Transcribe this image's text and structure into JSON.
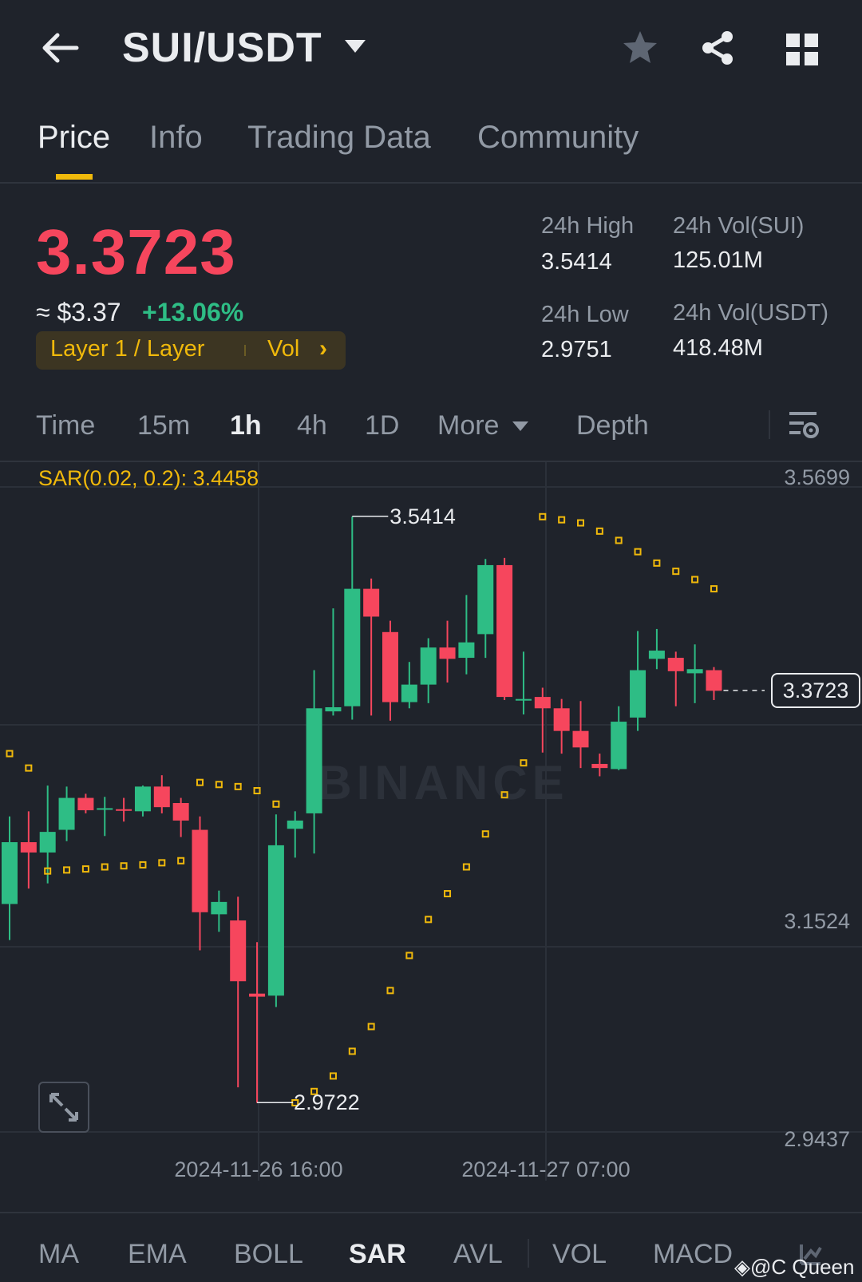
{
  "header": {
    "pair": "SUI/USDT",
    "icons": [
      "back-arrow-icon",
      "caret-down-icon",
      "star-icon",
      "share-icon",
      "grid-icon"
    ]
  },
  "tabs": [
    {
      "label": "Price",
      "active": true
    },
    {
      "label": "Info",
      "active": false
    },
    {
      "label": "Trading Data",
      "active": false
    },
    {
      "label": "Community",
      "active": false
    }
  ],
  "ticker": {
    "last_price": "3.3723",
    "usd_approx": "≈ $3.37",
    "change_pct": "+13.06%",
    "tag_sector": "Layer 1 / Layer",
    "tag_vol": "Vol",
    "stats": {
      "high_label": "24h High",
      "high_value": "3.5414",
      "low_label": "24h Low",
      "low_value": "2.9751",
      "vol_base_label": "24h Vol(SUI)",
      "vol_base_value": "125.01M",
      "vol_quote_label": "24h Vol(USDT)",
      "vol_quote_value": "418.48M"
    },
    "colors": {
      "down": "#f6465d",
      "up": "#2ebd85",
      "accent": "#f0b90b"
    }
  },
  "intervals": [
    {
      "label": "Time",
      "active": false
    },
    {
      "label": "15m",
      "active": false
    },
    {
      "label": "1h",
      "active": true
    },
    {
      "label": "4h",
      "active": false
    },
    {
      "label": "1D",
      "active": false
    },
    {
      "label": "More",
      "active": false
    },
    {
      "label": "Depth",
      "active": false
    }
  ],
  "chart_data": {
    "type": "candlestick",
    "indicator_legend": "SAR(0.02, 0.2): 3.4458",
    "watermark": "BINANCE",
    "y_ticks": [
      "3.5699",
      "3.1524",
      "2.9437"
    ],
    "ylim": [
      2.9437,
      3.5699
    ],
    "x_labels": [
      "2024-11-26 16:00",
      "2024-11-27 07:00"
    ],
    "high_marker": "3.5414",
    "low_marker": "2.9722",
    "current_price": "3.3723",
    "candles": [
      {
        "o": 3.165,
        "h": 3.25,
        "l": 3.13,
        "c": 3.225
      },
      {
        "o": 3.225,
        "h": 3.255,
        "l": 3.18,
        "c": 3.215
      },
      {
        "o": 3.215,
        "h": 3.28,
        "l": 3.185,
        "c": 3.235
      },
      {
        "o": 3.237,
        "h": 3.279,
        "l": 3.226,
        "c": 3.268
      },
      {
        "o": 3.268,
        "h": 3.272,
        "l": 3.253,
        "c": 3.256
      },
      {
        "o": 3.258,
        "h": 3.269,
        "l": 3.231,
        "c": 3.258
      },
      {
        "o": 3.257,
        "h": 3.268,
        "l": 3.245,
        "c": 3.256
      },
      {
        "o": 3.255,
        "h": 3.28,
        "l": 3.25,
        "c": 3.279
      },
      {
        "o": 3.279,
        "h": 3.29,
        "l": 3.253,
        "c": 3.259
      },
      {
        "o": 3.263,
        "h": 3.268,
        "l": 3.23,
        "c": 3.246
      },
      {
        "o": 3.237,
        "h": 3.25,
        "l": 3.12,
        "c": 3.157
      },
      {
        "o": 3.155,
        "h": 3.178,
        "l": 3.138,
        "c": 3.167
      },
      {
        "o": 3.149,
        "h": 3.172,
        "l": 2.987,
        "c": 3.09
      },
      {
        "o": 3.078,
        "h": 3.128,
        "l": 2.972,
        "c": 3.075
      },
      {
        "o": 3.076,
        "h": 3.252,
        "l": 3.065,
        "c": 3.222
      },
      {
        "o": 3.238,
        "h": 3.255,
        "l": 3.21,
        "c": 3.246
      },
      {
        "o": 3.253,
        "h": 3.392,
        "l": 3.214,
        "c": 3.355
      },
      {
        "o": 3.352,
        "h": 3.452,
        "l": 3.348,
        "c": 3.356
      },
      {
        "o": 3.357,
        "h": 3.541,
        "l": 3.344,
        "c": 3.471
      },
      {
        "o": 3.471,
        "h": 3.481,
        "l": 3.348,
        "c": 3.444
      },
      {
        "o": 3.429,
        "h": 3.44,
        "l": 3.343,
        "c": 3.361
      },
      {
        "o": 3.361,
        "h": 3.4,
        "l": 3.355,
        "c": 3.378
      },
      {
        "o": 3.378,
        "h": 3.423,
        "l": 3.36,
        "c": 3.414
      },
      {
        "o": 3.414,
        "h": 3.44,
        "l": 3.38,
        "c": 3.403
      },
      {
        "o": 3.404,
        "h": 3.465,
        "l": 3.388,
        "c": 3.419
      },
      {
        "o": 3.427,
        "h": 3.5,
        "l": 3.404,
        "c": 3.494
      },
      {
        "o": 3.494,
        "h": 3.501,
        "l": 3.363,
        "c": 3.366
      },
      {
        "o": 3.363,
        "h": 3.41,
        "l": 3.349,
        "c": 3.364
      },
      {
        "o": 3.366,
        "h": 3.375,
        "l": 3.312,
        "c": 3.355
      },
      {
        "o": 3.355,
        "h": 3.364,
        "l": 3.311,
        "c": 3.333
      },
      {
        "o": 3.333,
        "h": 3.362,
        "l": 3.297,
        "c": 3.317
      },
      {
        "o": 3.301,
        "h": 3.311,
        "l": 3.289,
        "c": 3.297
      },
      {
        "o": 3.296,
        "h": 3.357,
        "l": 3.295,
        "c": 3.342
      },
      {
        "o": 3.346,
        "h": 3.43,
        "l": 3.333,
        "c": 3.392
      },
      {
        "o": 3.403,
        "h": 3.432,
        "l": 3.393,
        "c": 3.411
      },
      {
        "o": 3.404,
        "h": 3.41,
        "l": 3.357,
        "c": 3.391
      },
      {
        "o": 3.389,
        "h": 3.417,
        "l": 3.36,
        "c": 3.393
      },
      {
        "o": 3.392,
        "h": 3.395,
        "l": 3.363,
        "c": 3.372
      }
    ],
    "sar": [
      {
        "i": 0,
        "v": 3.311
      },
      {
        "i": 1,
        "v": 3.297
      },
      {
        "i": 2,
        "v": 3.197
      },
      {
        "i": 3,
        "v": 3.198
      },
      {
        "i": 4,
        "v": 3.199
      },
      {
        "i": 5,
        "v": 3.201
      },
      {
        "i": 6,
        "v": 3.202
      },
      {
        "i": 7,
        "v": 3.203
      },
      {
        "i": 8,
        "v": 3.205
      },
      {
        "i": 9,
        "v": 3.207
      },
      {
        "i": 10,
        "v": 3.283
      },
      {
        "i": 11,
        "v": 3.281
      },
      {
        "i": 12,
        "v": 3.279
      },
      {
        "i": 13,
        "v": 3.275
      },
      {
        "i": 14,
        "v": 3.262
      },
      {
        "i": 15,
        "v": 2.972
      },
      {
        "i": 16,
        "v": 2.983
      },
      {
        "i": 17,
        "v": 2.998
      },
      {
        "i": 18,
        "v": 3.022
      },
      {
        "i": 19,
        "v": 3.046
      },
      {
        "i": 20,
        "v": 3.081
      },
      {
        "i": 21,
        "v": 3.115
      },
      {
        "i": 22,
        "v": 3.15
      },
      {
        "i": 23,
        "v": 3.175
      },
      {
        "i": 24,
        "v": 3.201
      },
      {
        "i": 25,
        "v": 3.233
      },
      {
        "i": 26,
        "v": 3.271
      },
      {
        "i": 27,
        "v": 3.302
      },
      {
        "i": 28,
        "v": 3.541
      },
      {
        "i": 29,
        "v": 3.538
      },
      {
        "i": 30,
        "v": 3.535
      },
      {
        "i": 31,
        "v": 3.527
      },
      {
        "i": 32,
        "v": 3.518
      },
      {
        "i": 33,
        "v": 3.507
      },
      {
        "i": 34,
        "v": 3.496
      },
      {
        "i": 35,
        "v": 3.488
      },
      {
        "i": 36,
        "v": 3.48
      },
      {
        "i": 37,
        "v": 3.471
      }
    ]
  },
  "indicators": [
    {
      "label": "MA",
      "active": false
    },
    {
      "label": "EMA",
      "active": false
    },
    {
      "label": "BOLL",
      "active": false
    },
    {
      "label": "SAR",
      "active": true
    },
    {
      "label": "AVL",
      "active": false
    },
    {
      "label": "VOL",
      "active": false
    },
    {
      "label": "MACD",
      "active": false
    }
  ],
  "watermark_user": "@C Queen"
}
